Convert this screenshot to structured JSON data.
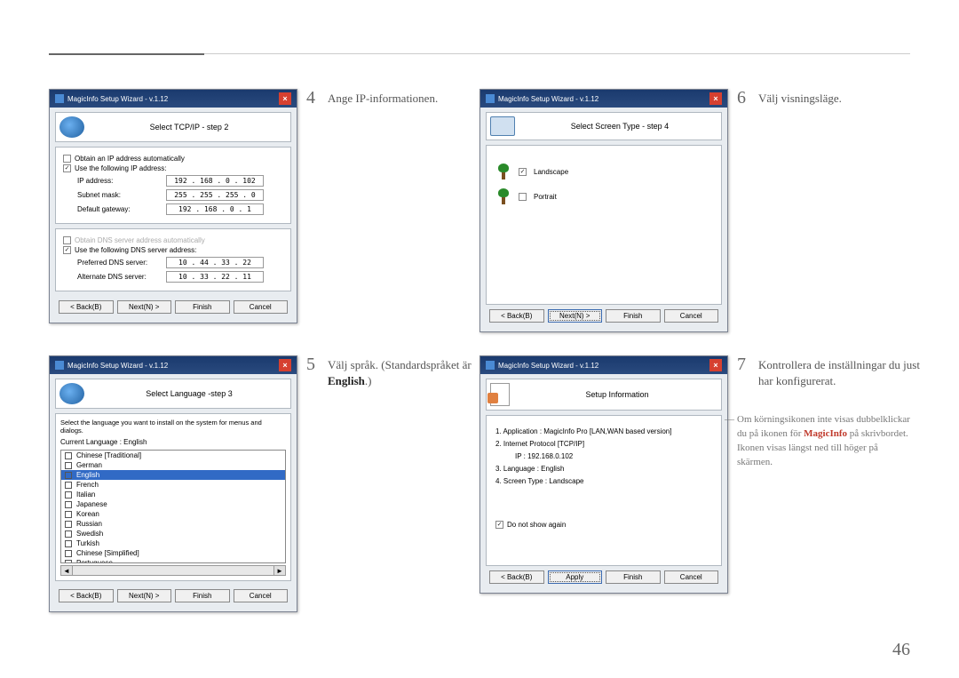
{
  "page_number": "46",
  "wizard_title": "MagicInfo Setup Wizard - v.1.12",
  "buttons": {
    "back": "< Back(B)",
    "next": "Next(N) >",
    "finish": "Finish",
    "cancel": "Cancel",
    "apply": "Apply"
  },
  "tcp": {
    "step_title": "Select TCP/IP - step 2",
    "auto_ip": "Obtain an IP address automatically",
    "use_ip": "Use the following IP address:",
    "ip_lbl": "IP address:",
    "ip_val": "192 . 168 .  0  . 102",
    "sn_lbl": "Subnet mask:",
    "sn_val": "255 . 255 . 255 .  0",
    "gw_lbl": "Default gateway:",
    "gw_val": "192 . 168 .  0  .  1",
    "auto_dns": "Obtain DNS server address automatically",
    "use_dns": "Use the following DNS server address:",
    "pdns_lbl": "Preferred DNS server:",
    "pdns_val": "10 . 44 . 33 . 22",
    "adns_lbl": "Alternate DNS server:",
    "adns_val": "10 . 33 . 22 . 11"
  },
  "lang": {
    "step_title": "Select Language -step 3",
    "intro": "Select the language you want to install on the system for menus and dialogs.",
    "current_lbl": "Current Language    :    English",
    "items": [
      "Chinese [Traditional]",
      "German",
      "English",
      "French",
      "Italian",
      "Japanese",
      "Korean",
      "Russian",
      "Swedish",
      "Turkish",
      "Chinese [Simplified]",
      "Portuguese"
    ]
  },
  "screen": {
    "step_title": "Select Screen Type - step 4",
    "landscape": "Landscape",
    "portrait": "Portrait"
  },
  "info": {
    "step_title": "Setup Information",
    "l1": "1. Application :    MagicInfo Pro [LAN,WAN based version]",
    "l2": "2. Internet Protocol [TCP/IP]",
    "l2a": "IP :    192.168.0.102",
    "l3": "3. Language :    English",
    "l4": "4. Screen Type :    Landscape",
    "dns": "Do not show again"
  },
  "captions": {
    "c4": "Ange IP-informationen.",
    "c5a": "Välj språk. (Standardspråket är ",
    "c5b": "English",
    "c5c": ".)",
    "c6": "Välj visningsläge.",
    "c7": "Kontrollera de inställningar du just har konfigurerat."
  },
  "note": {
    "t1": "Om körningsikonen inte visas dubbelklickar du på ikonen för ",
    "brand": "MagicInfo",
    "t2": " på skrivbordet. Ikonen visas längst ned till höger på skärmen."
  }
}
